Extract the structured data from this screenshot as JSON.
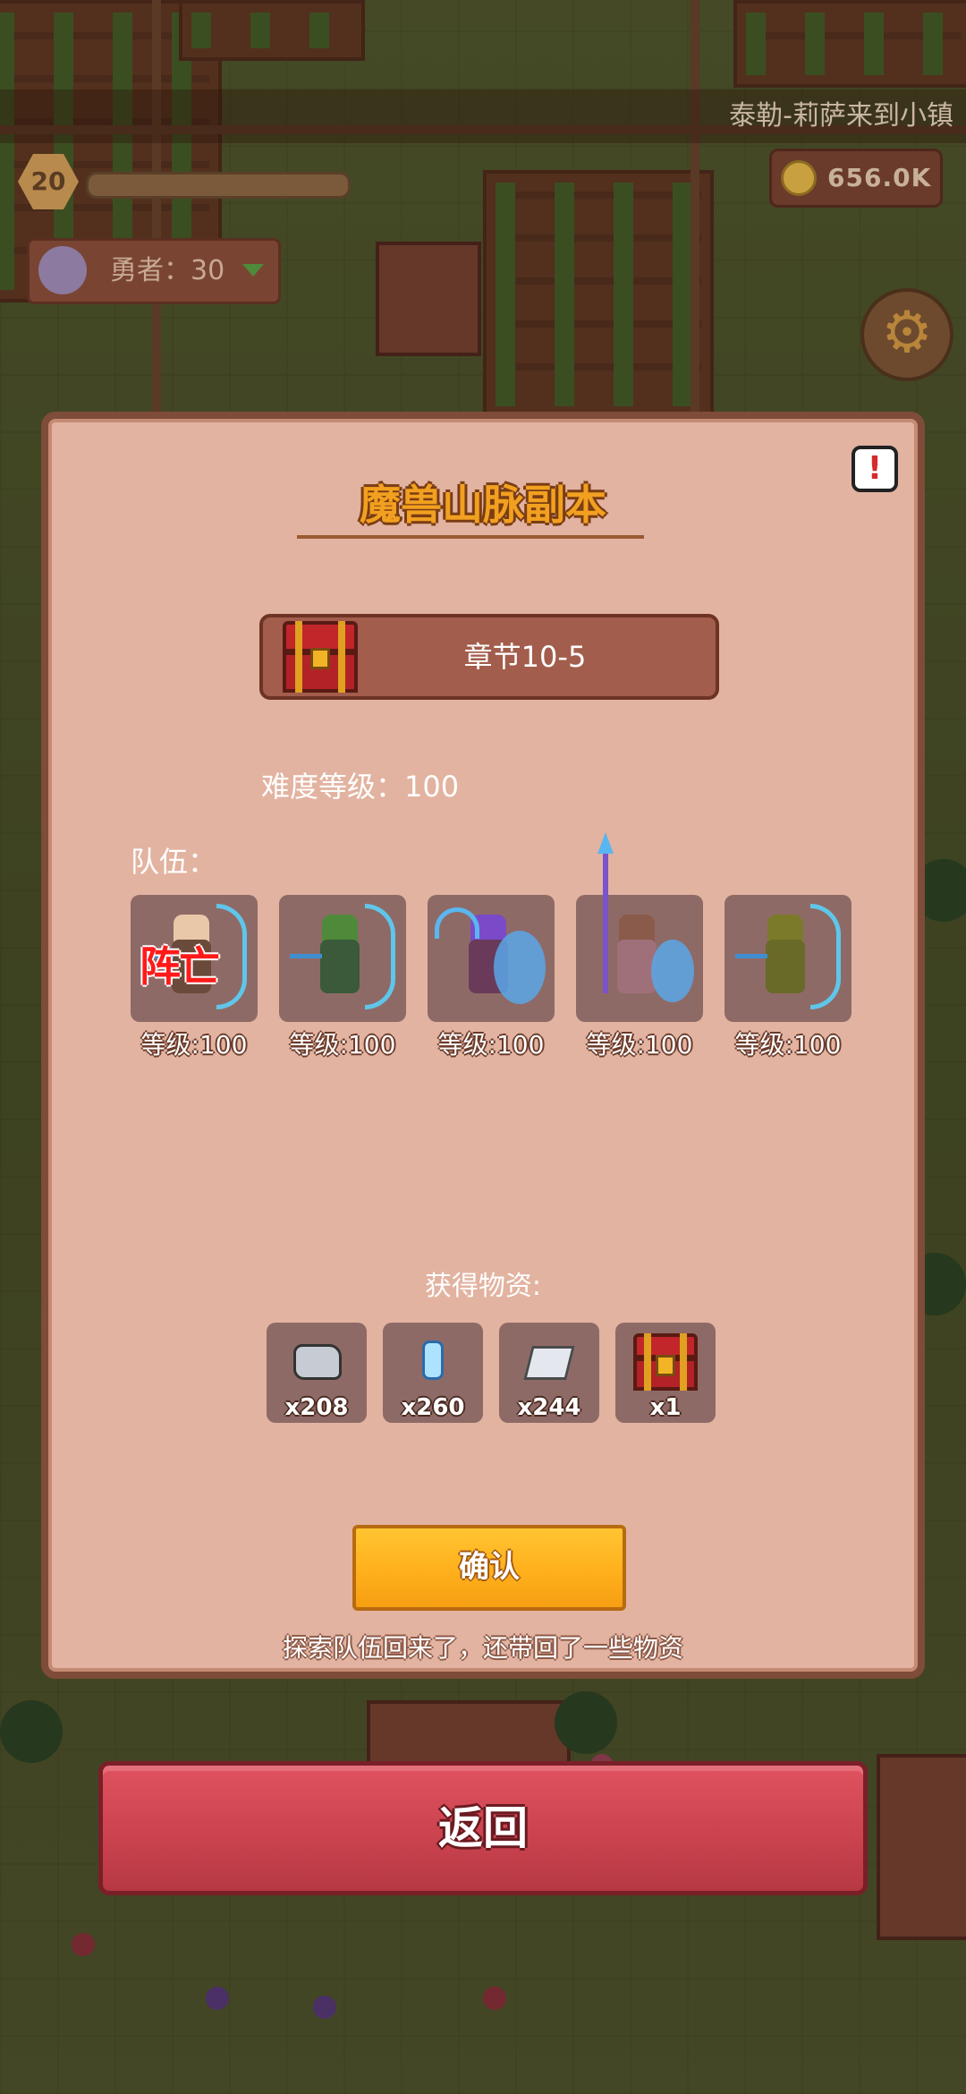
{
  "hud": {
    "news_ticker": "泰勒-莉萨来到小镇",
    "player_level": "20",
    "coins": "656.0K",
    "hero_count_label": "勇者：30"
  },
  "dialog": {
    "title": "魔兽山脉副本",
    "chapter": "章节10-5",
    "difficulty": "难度等级：100",
    "team_label": "队伍：",
    "members": [
      {
        "level_label": "等级:100",
        "status": "阵亡",
        "icon": "archer-bald"
      },
      {
        "level_label": "等级:100",
        "status": "",
        "icon": "archer-orc"
      },
      {
        "level_label": "等级:100",
        "status": "",
        "icon": "scythe-shield-mage"
      },
      {
        "level_label": "等级:100",
        "status": "",
        "icon": "spear-shield-warrior"
      },
      {
        "level_label": "等级:100",
        "status": "",
        "icon": "hooded-archer"
      }
    ],
    "loot_label": "获得物资:",
    "loot": [
      {
        "icon": "ore-icon",
        "count": "x208"
      },
      {
        "icon": "crystal-icon",
        "count": "x260"
      },
      {
        "icon": "ingot-icon",
        "count": "x244"
      },
      {
        "icon": "chest-icon",
        "count": "x1"
      }
    ],
    "confirm_label": "确认",
    "footer_message": "探索队伍回来了，还带回了一些物资"
  },
  "back_label": "返回",
  "colors": {
    "dialog_bg": "#e2b3a0",
    "title": "#f2a020",
    "confirm": "#ffb01c",
    "back": "#c9424e",
    "dead": "#ff1a1a"
  }
}
